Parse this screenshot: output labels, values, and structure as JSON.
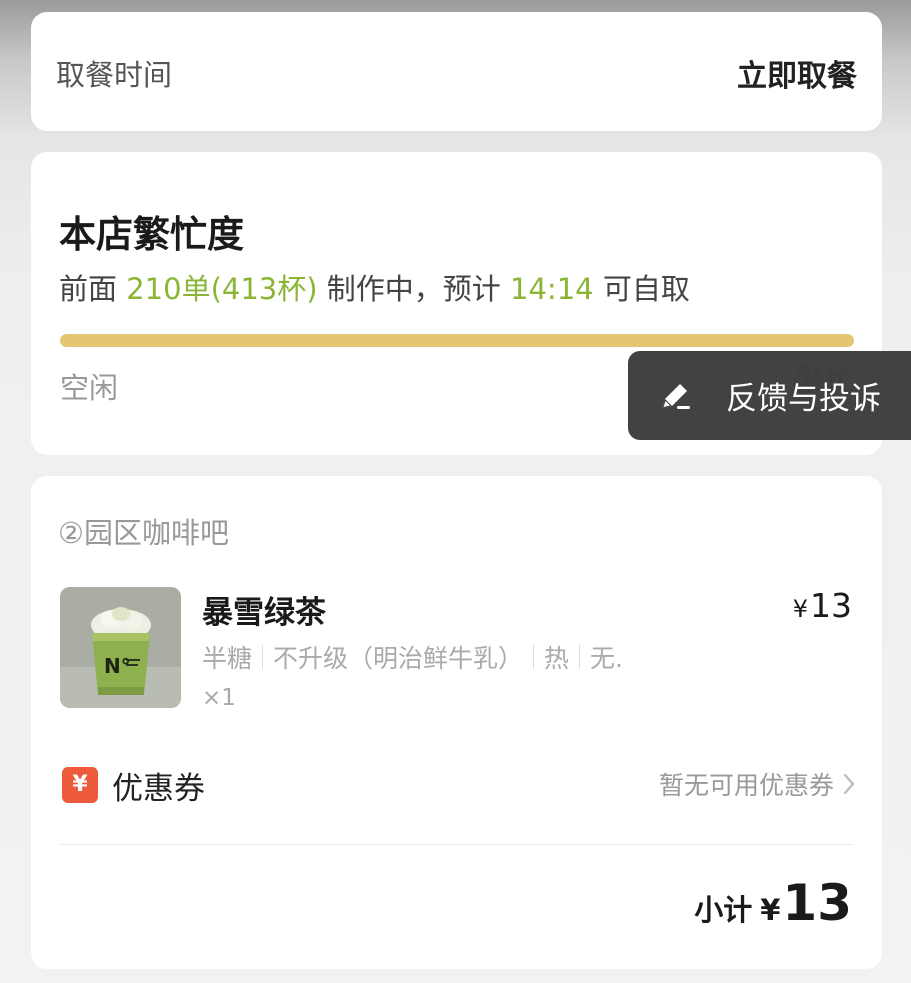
{
  "pickup": {
    "label": "取餐时间",
    "value": "立即取餐"
  },
  "busyness": {
    "title": "本店繁忙度",
    "info_prefix": "前面",
    "orders_ahead": "210单(413杯)",
    "info_middle": "制作中，预计",
    "eta_time": "14:14",
    "info_suffix": "可自取",
    "level_percent": 100,
    "scale_min_label": "空闲",
    "scale_max_label": "繁忙",
    "bar_color": "#e4c670",
    "highlight_color": "#8bb534"
  },
  "feedback": {
    "icon": "edit-pencil-icon",
    "label": "反馈与投诉"
  },
  "order": {
    "store_name": "②园区咖啡吧",
    "item": {
      "name": "暴雪绿茶",
      "currency": "¥",
      "price": "13",
      "specs": [
        "半糖",
        "不升级（明治鲜牛乳）",
        "热",
        "无."
      ],
      "quantity": "×1"
    },
    "coupon": {
      "badge": "¥",
      "label": "优惠券",
      "status": "暂无可用优惠券",
      "badge_color": "#ee5a3c"
    },
    "subtotal": {
      "label": "小计",
      "currency": "¥",
      "value": "13"
    }
  }
}
